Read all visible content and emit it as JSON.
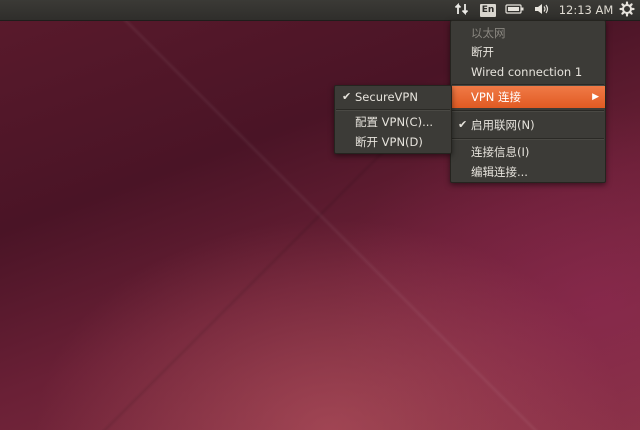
{
  "panel": {
    "keyboard_layout": "En",
    "clock": "12:13 AM",
    "icons": [
      "network-transfer-icon",
      "battery-icon",
      "volume-icon",
      "gear-icon"
    ]
  },
  "network_menu": {
    "section_header": "以太网",
    "disconnect": "断开",
    "wired_connection": "Wired connection 1",
    "vpn_connections": "VPN 连接",
    "enable_networking": "启用联网(N)",
    "connection_info": "连接信息(I)",
    "edit_connections": "编辑连接..."
  },
  "vpn_submenu": {
    "secure_vpn": "SecureVPN",
    "configure_vpn": "配置 VPN(C)...",
    "disconnect_vpn": "断开 VPN(D)"
  },
  "colors": {
    "highlight": "#e95420",
    "panel": "#2f2e2b",
    "menu_bg": "#3c3b37"
  }
}
